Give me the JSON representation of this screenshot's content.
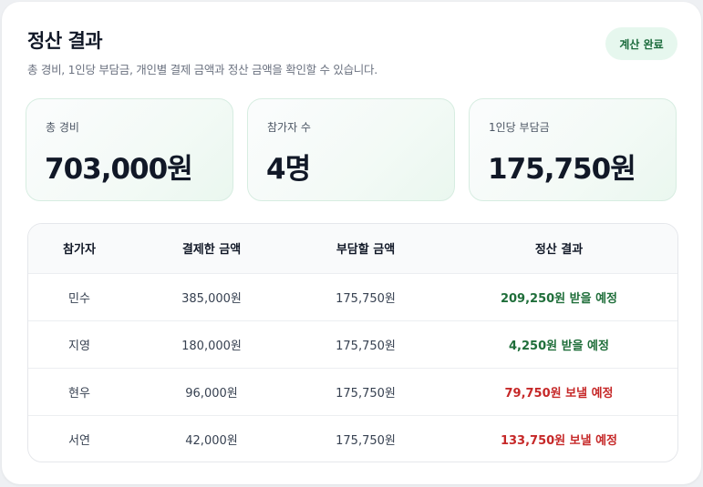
{
  "header": {
    "title": "정산 결과",
    "subtitle": "총 경비, 1인당 부담금, 개인별 결제 금액과 정산 금액을 확인할 수 있습니다.",
    "status": "계산 완료"
  },
  "stats": [
    {
      "label": "총 경비",
      "value": "703,000원"
    },
    {
      "label": "참가자 수",
      "value": "4명"
    },
    {
      "label": "1인당 부담금",
      "value": "175,750원"
    }
  ],
  "table": {
    "headers": [
      "참가자",
      "결제한 금액",
      "부담할 금액",
      "정산 결과"
    ],
    "rows": [
      {
        "name": "민수",
        "paid": "385,000원",
        "share": "175,750원",
        "result": "209,250원 받을 예정",
        "type": "receive"
      },
      {
        "name": "지영",
        "paid": "180,000원",
        "share": "175,750원",
        "result": "4,250원 받을 예정",
        "type": "receive"
      },
      {
        "name": "현우",
        "paid": "96,000원",
        "share": "175,750원",
        "result": "79,750원 보낼 예정",
        "type": "send"
      },
      {
        "name": "서연",
        "paid": "42,000원",
        "share": "175,750원",
        "result": "133,750원 보낼 예정",
        "type": "send"
      }
    ]
  },
  "colors": {
    "receive": "#1f6e3a",
    "send": "#c62828",
    "status_bg": "#e6f7ee"
  }
}
